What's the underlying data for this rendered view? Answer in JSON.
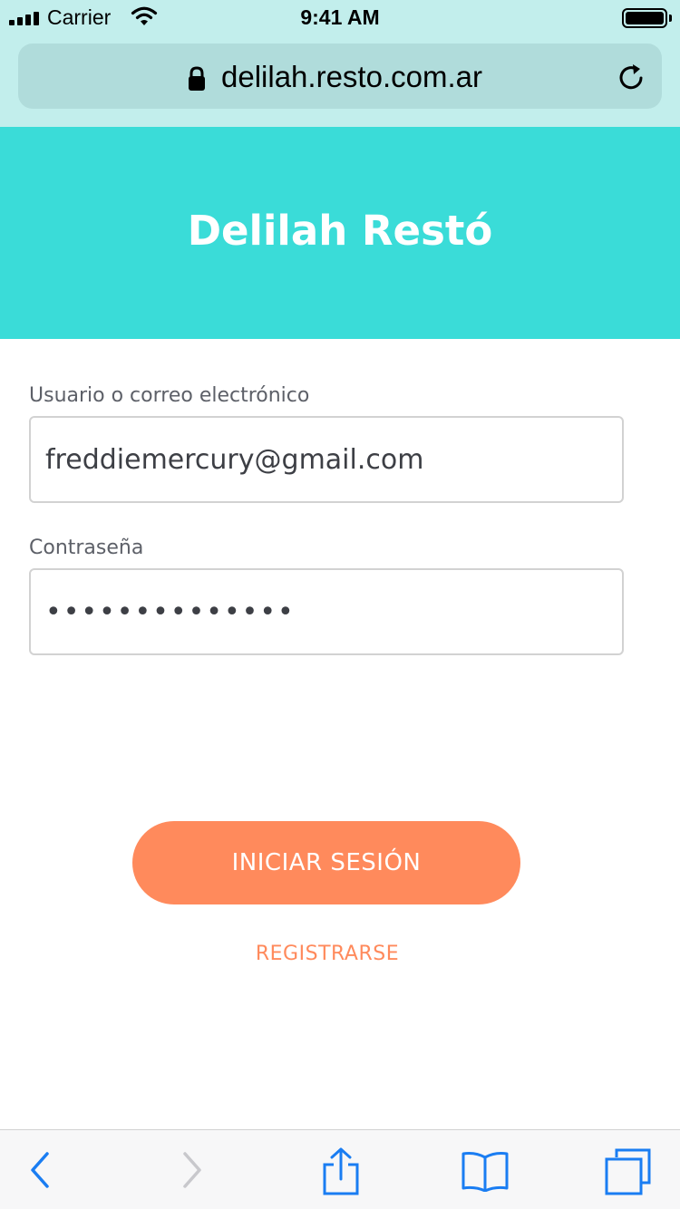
{
  "status_bar": {
    "carrier": "Carrier",
    "time": "9:41 AM"
  },
  "browser": {
    "url": "delilah.resto.com.ar"
  },
  "header": {
    "title": "Delilah Restó",
    "background": "#3adcd8"
  },
  "form": {
    "username_label": "Usuario o correo electrónico",
    "username_value": "freddiemercury@gmail.com",
    "password_label": "Contraseña",
    "password_value": "••••••••••••••"
  },
  "actions": {
    "login_label": "INICIAR SESIÓN",
    "register_label": "REGISTRARSE",
    "accent": "#ff8a5c"
  },
  "toolbar": {
    "icons": [
      "back-icon",
      "forward-icon",
      "share-icon",
      "bookmarks-icon",
      "tabs-icon"
    ],
    "tint": "#1a7df2"
  }
}
